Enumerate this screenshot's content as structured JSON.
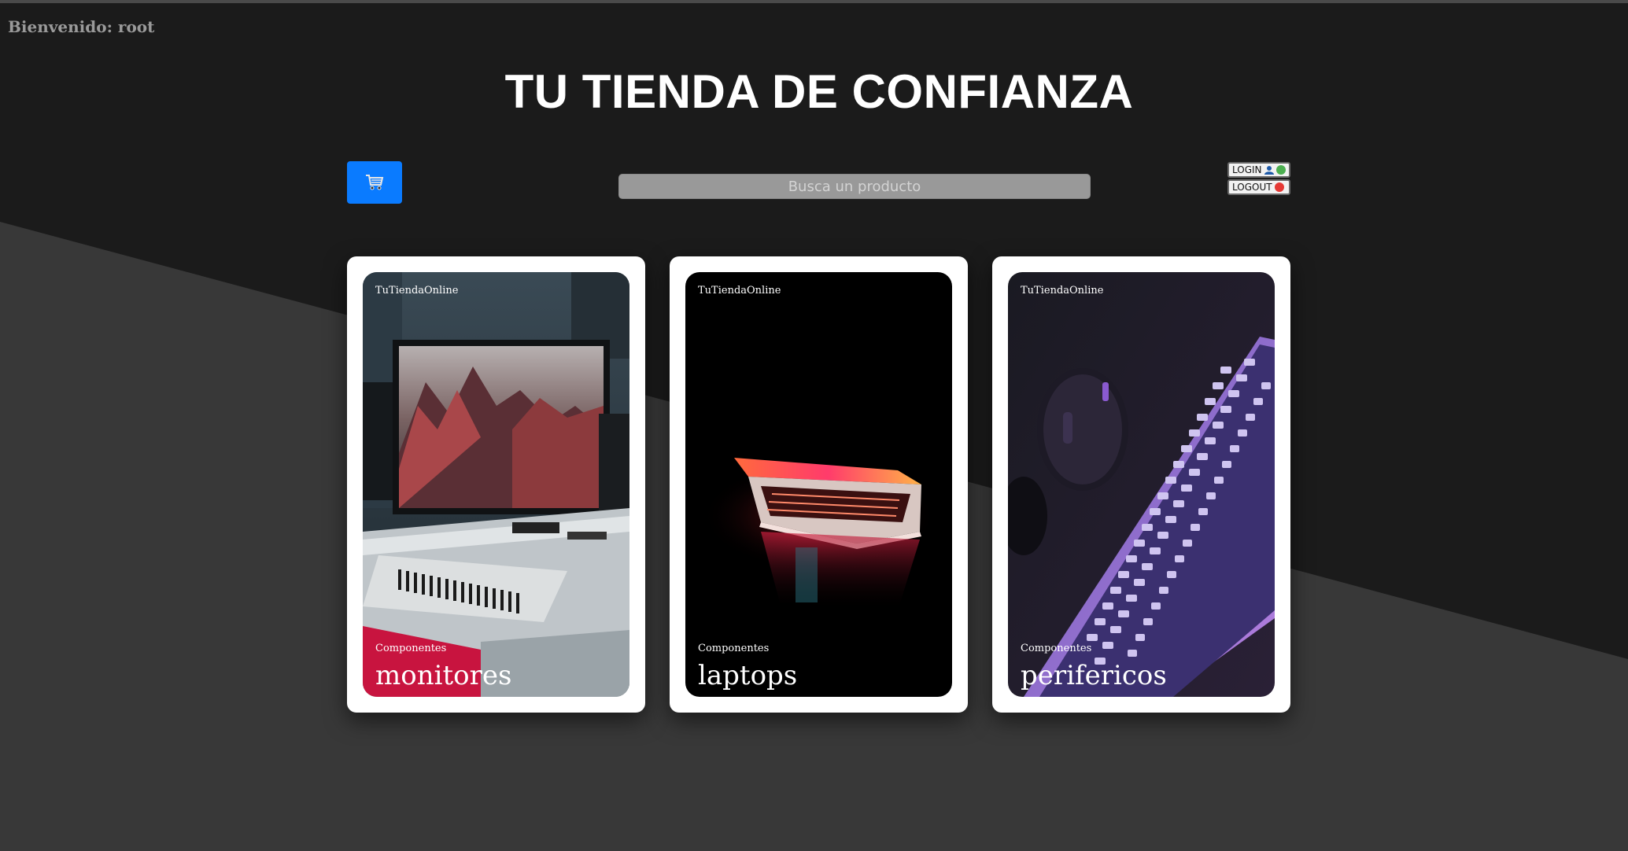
{
  "header": {
    "welcome_text": "Bienvenido: root",
    "title": "TU TIENDA DE CONFIANZA"
  },
  "toolbar": {
    "cart_icon": "shopping-cart-icon",
    "search_placeholder": "Busca un producto",
    "login_label": "LOGIN",
    "logout_label": "LOGOUT"
  },
  "cards": [
    {
      "brand": "TuTiendaOnline",
      "category": "Componentes",
      "title": "monitores",
      "image": "monitor-studio-photo"
    },
    {
      "brand": "TuTiendaOnline",
      "category": "Componentes",
      "title": "laptops",
      "image": "laptop-glow-photo"
    },
    {
      "brand": "TuTiendaOnline",
      "category": "Componentes",
      "title": "perifericos",
      "image": "keyboard-mouse-photo"
    }
  ],
  "colors": {
    "background_dark": "#1b1b1b",
    "background_band": "#383838",
    "cart_button": "#0a7bff",
    "login_status": "#4caf50",
    "logout_status": "#e53935"
  }
}
